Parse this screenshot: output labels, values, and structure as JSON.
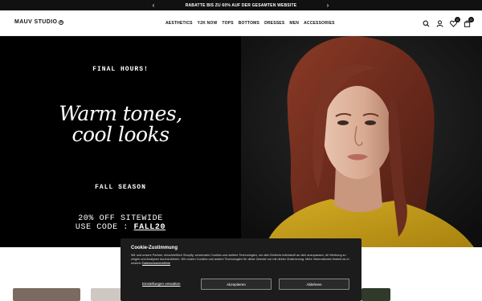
{
  "announcement": {
    "message": "RABATTE BIS ZU 60% AUF DER GESAMTEN WEBSITE",
    "prev_arrow": "‹",
    "next_arrow": "›"
  },
  "header": {
    "logo": "MAUV STUDIO",
    "logo_mark": "R",
    "nav": [
      "AESTHETICS",
      "Y2K NOW",
      "TOPS",
      "BOTTOMS",
      "DRESSES",
      "MEN",
      "ACCESSORIES"
    ],
    "wishlist_count": "0",
    "cart_count": "0"
  },
  "hero": {
    "kicker": "FINAL HOURS!",
    "headline_line1": "Warm tones,",
    "headline_line2": "cool looks",
    "season": "FALL SEASON",
    "offer_line1": "20% OFF SITEWIDE",
    "offer_prefix": "USE CODE : ",
    "offer_code": "FALL20"
  },
  "cookie": {
    "title": "Cookie-Zustimmung",
    "text": "Wir und unsere Partner, einschließlich Shopify, verwenden Cookies und weitere Technologien, um dein Erlebnis individuell an dich anzupassen, dir Werbung zu zeigen und Analysen durchzuführen. Wir nutzen Cookies und andere Technologien für diese Zwecke nur mit deiner Zustimmung. Mehr Informationen findest du in unserer ",
    "policy_link": "Datenschutzrichtlinie",
    "preferences": "Einstellungen verwalten",
    "accept": "Akzeptieren",
    "decline": "Ablehnen"
  },
  "colors": {
    "hero_left_bg": "#000000",
    "announcement_bg": "#111111",
    "sweater": "#c9a21a",
    "hair": "#7a3424",
    "cookie_bg": "#1c1c1c"
  }
}
